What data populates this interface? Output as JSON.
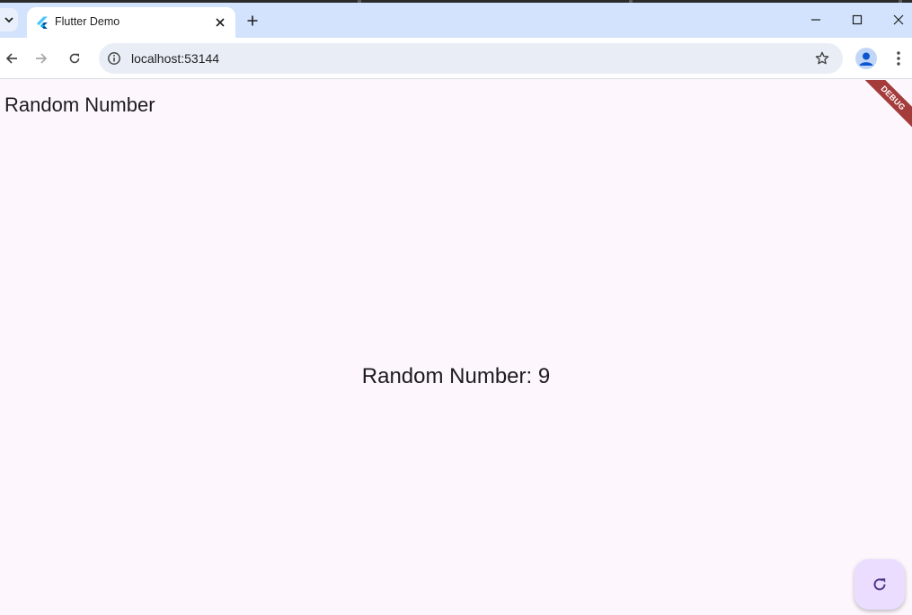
{
  "browser": {
    "tab": {
      "title": "Flutter Demo"
    },
    "address": {
      "url": "localhost:53144"
    }
  },
  "app": {
    "title": "Random Number",
    "result_text": "Random Number: 9",
    "debug_banner": "DEBUG",
    "fab_icon": "refresh-icon"
  },
  "colors": {
    "app_background": "#fdf7fd",
    "fab_background": "#eaddff",
    "debug_banner": "#a53c3c",
    "tab_bar": "#d3e3fd"
  }
}
